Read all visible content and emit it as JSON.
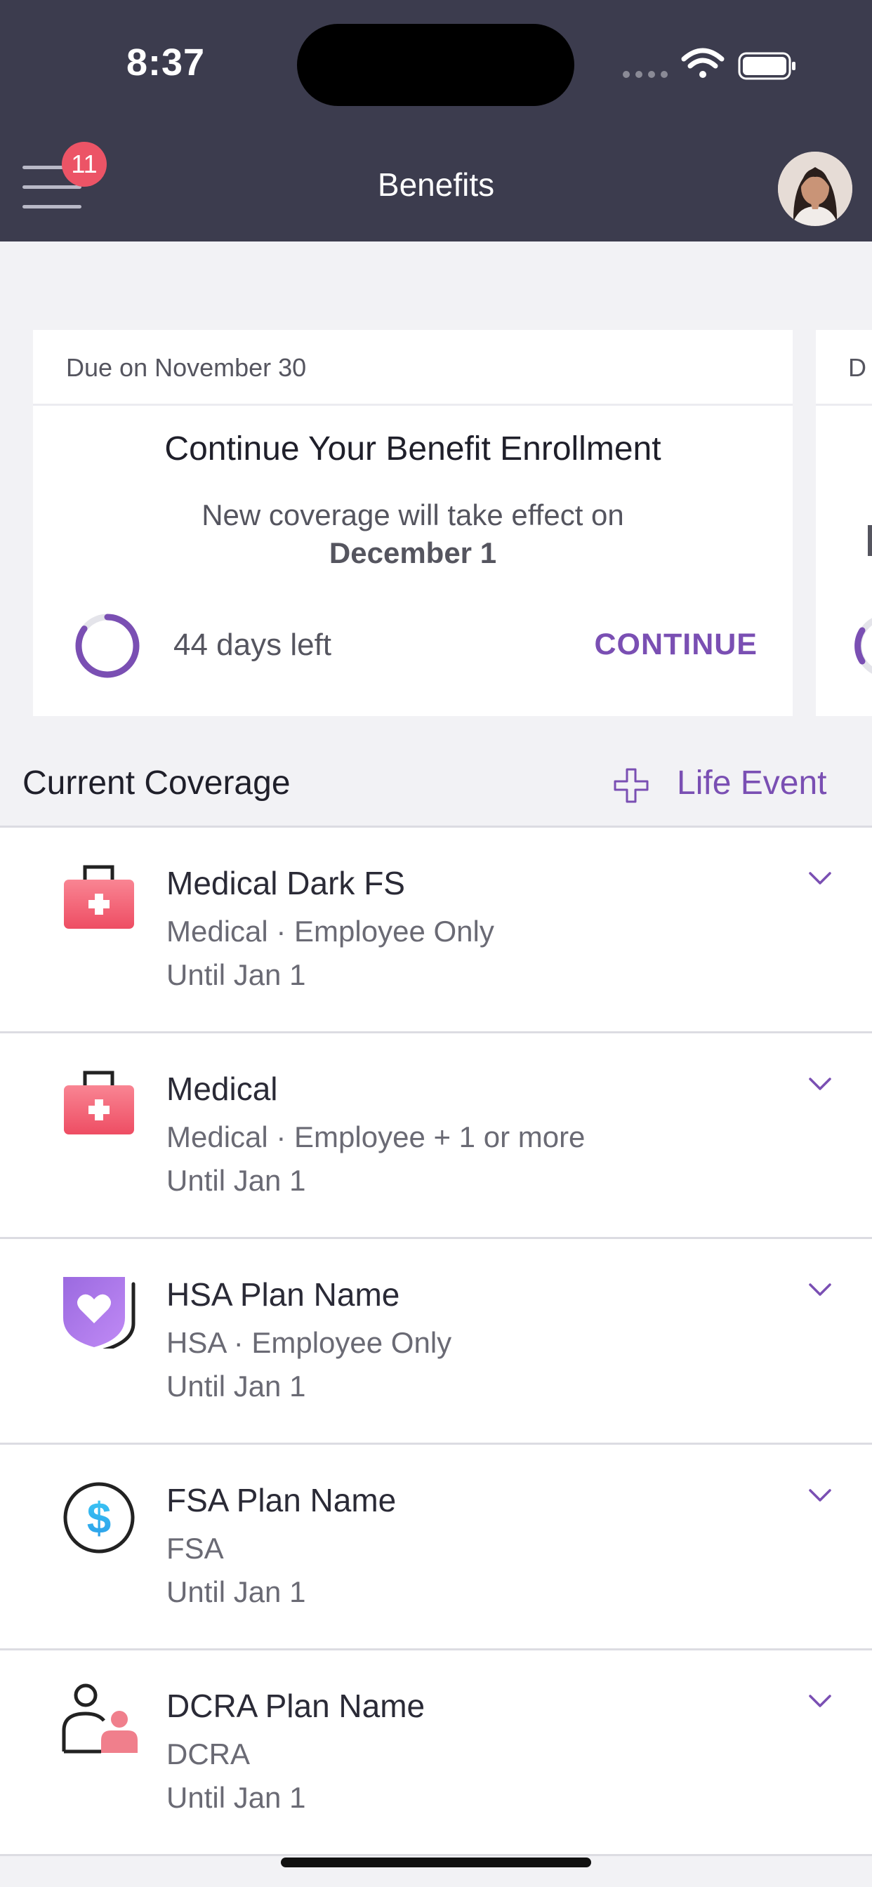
{
  "status_bar": {
    "time": "8:37",
    "icons": [
      "signal-dots-icon",
      "wifi-icon",
      "battery-icon"
    ]
  },
  "header": {
    "title": "Benefits",
    "notification_count": "11"
  },
  "enrollment_card": {
    "due": "Due on November 30",
    "title": "Continue Your Benefit Enrollment",
    "subtitle": "New coverage will take effect on",
    "effective_date": "December 1",
    "days_left": "44 days left",
    "days_left_progress": 0.85,
    "action": "CONTINUE"
  },
  "peek_card": {
    "due_fragment": "D"
  },
  "coverage": {
    "title": "Current Coverage",
    "life_event_label": "Life Event",
    "items": [
      {
        "name": "Medical Dark FS",
        "detail": "Medical · Employee Only",
        "until": "Until Jan 1",
        "icon": "medical-kit-icon"
      },
      {
        "name": "Medical",
        "detail": "Medical · Employee + 1 or more",
        "until": "Until Jan 1",
        "icon": "medical-kit-icon"
      },
      {
        "name": "HSA Plan Name",
        "detail": "HSA · Employee Only",
        "until": "Until Jan 1",
        "icon": "heart-shield-icon"
      },
      {
        "name": "FSA Plan Name",
        "detail": "FSA",
        "until": "Until Jan 1",
        "icon": "dollar-coin-icon"
      },
      {
        "name": "DCRA Plan Name",
        "detail": "DCRA",
        "until": "Until Jan 1",
        "icon": "dependents-icon"
      }
    ]
  },
  "colors": {
    "header_bg": "#3c3c4e",
    "accent": "#7a4fb3",
    "badge": "#ec5466"
  }
}
